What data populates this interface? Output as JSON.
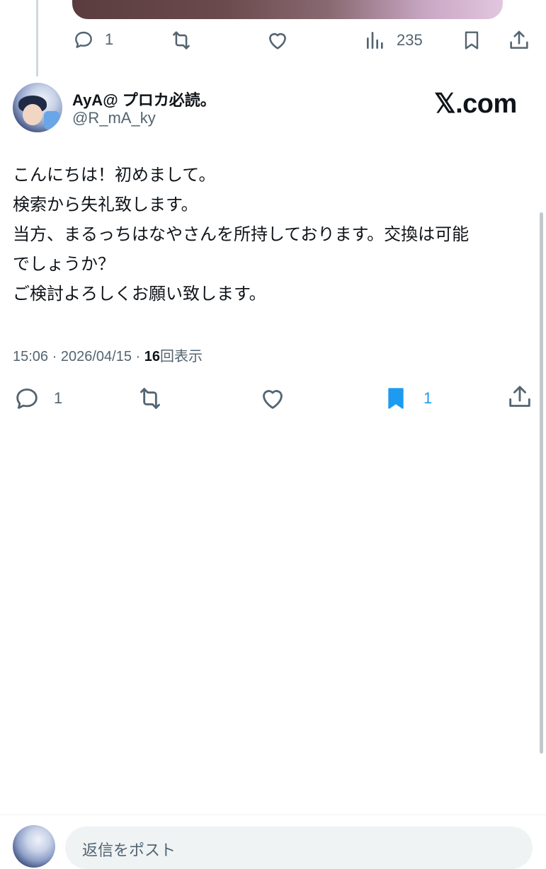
{
  "parent_post": {
    "actions": {
      "reply_count": "1",
      "views_count": "235"
    }
  },
  "post": {
    "author": {
      "display_name": "AyA@ プロカ必読。",
      "handle": "@R_mA_ky"
    },
    "brand": "𝕏.com",
    "body_lines": [
      "こんにちは！初めまして。",
      "検索から失礼致します。",
      "当方、まるっちはなやさんを所持しております。交換は可能",
      "でしょうか？",
      "ご検討よろしくお願い致します。"
    ],
    "meta": {
      "time": "15:06",
      "separator": "·",
      "date": "2026/04/15",
      "views": "16",
      "views_label": "回表示"
    },
    "actions": {
      "reply_count": "1",
      "bookmark_count": "1"
    }
  },
  "reply_composer": {
    "placeholder": "返信をポスト"
  },
  "colors": {
    "text": "#0f1419",
    "muted": "#536471",
    "accent": "#1d9bf0"
  },
  "icons": [
    "reply-icon",
    "repost-icon",
    "like-icon",
    "views-icon",
    "bookmark-icon",
    "share-icon"
  ]
}
